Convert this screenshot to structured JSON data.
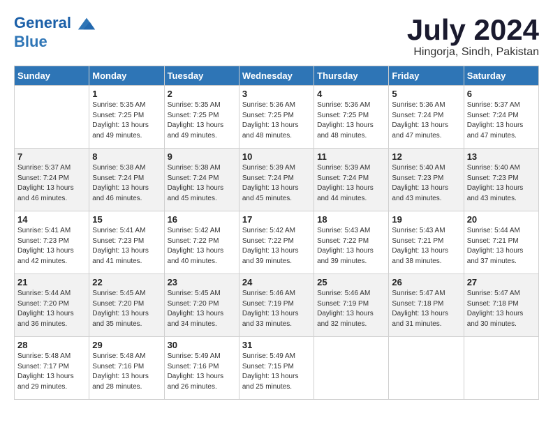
{
  "header": {
    "logo_line1": "General",
    "logo_line2": "Blue",
    "month": "July 2024",
    "location": "Hingorja, Sindh, Pakistan"
  },
  "weekdays": [
    "Sunday",
    "Monday",
    "Tuesday",
    "Wednesday",
    "Thursday",
    "Friday",
    "Saturday"
  ],
  "weeks": [
    [
      {
        "num": "",
        "info": ""
      },
      {
        "num": "1",
        "info": "Sunrise: 5:35 AM\nSunset: 7:25 PM\nDaylight: 13 hours\nand 49 minutes."
      },
      {
        "num": "2",
        "info": "Sunrise: 5:35 AM\nSunset: 7:25 PM\nDaylight: 13 hours\nand 49 minutes."
      },
      {
        "num": "3",
        "info": "Sunrise: 5:36 AM\nSunset: 7:25 PM\nDaylight: 13 hours\nand 48 minutes."
      },
      {
        "num": "4",
        "info": "Sunrise: 5:36 AM\nSunset: 7:25 PM\nDaylight: 13 hours\nand 48 minutes."
      },
      {
        "num": "5",
        "info": "Sunrise: 5:36 AM\nSunset: 7:24 PM\nDaylight: 13 hours\nand 47 minutes."
      },
      {
        "num": "6",
        "info": "Sunrise: 5:37 AM\nSunset: 7:24 PM\nDaylight: 13 hours\nand 47 minutes."
      }
    ],
    [
      {
        "num": "7",
        "info": "Sunrise: 5:37 AM\nSunset: 7:24 PM\nDaylight: 13 hours\nand 46 minutes."
      },
      {
        "num": "8",
        "info": "Sunrise: 5:38 AM\nSunset: 7:24 PM\nDaylight: 13 hours\nand 46 minutes."
      },
      {
        "num": "9",
        "info": "Sunrise: 5:38 AM\nSunset: 7:24 PM\nDaylight: 13 hours\nand 45 minutes."
      },
      {
        "num": "10",
        "info": "Sunrise: 5:39 AM\nSunset: 7:24 PM\nDaylight: 13 hours\nand 45 minutes."
      },
      {
        "num": "11",
        "info": "Sunrise: 5:39 AM\nSunset: 7:24 PM\nDaylight: 13 hours\nand 44 minutes."
      },
      {
        "num": "12",
        "info": "Sunrise: 5:40 AM\nSunset: 7:23 PM\nDaylight: 13 hours\nand 43 minutes."
      },
      {
        "num": "13",
        "info": "Sunrise: 5:40 AM\nSunset: 7:23 PM\nDaylight: 13 hours\nand 43 minutes."
      }
    ],
    [
      {
        "num": "14",
        "info": "Sunrise: 5:41 AM\nSunset: 7:23 PM\nDaylight: 13 hours\nand 42 minutes."
      },
      {
        "num": "15",
        "info": "Sunrise: 5:41 AM\nSunset: 7:23 PM\nDaylight: 13 hours\nand 41 minutes."
      },
      {
        "num": "16",
        "info": "Sunrise: 5:42 AM\nSunset: 7:22 PM\nDaylight: 13 hours\nand 40 minutes."
      },
      {
        "num": "17",
        "info": "Sunrise: 5:42 AM\nSunset: 7:22 PM\nDaylight: 13 hours\nand 39 minutes."
      },
      {
        "num": "18",
        "info": "Sunrise: 5:43 AM\nSunset: 7:22 PM\nDaylight: 13 hours\nand 39 minutes."
      },
      {
        "num": "19",
        "info": "Sunrise: 5:43 AM\nSunset: 7:21 PM\nDaylight: 13 hours\nand 38 minutes."
      },
      {
        "num": "20",
        "info": "Sunrise: 5:44 AM\nSunset: 7:21 PM\nDaylight: 13 hours\nand 37 minutes."
      }
    ],
    [
      {
        "num": "21",
        "info": "Sunrise: 5:44 AM\nSunset: 7:20 PM\nDaylight: 13 hours\nand 36 minutes."
      },
      {
        "num": "22",
        "info": "Sunrise: 5:45 AM\nSunset: 7:20 PM\nDaylight: 13 hours\nand 35 minutes."
      },
      {
        "num": "23",
        "info": "Sunrise: 5:45 AM\nSunset: 7:20 PM\nDaylight: 13 hours\nand 34 minutes."
      },
      {
        "num": "24",
        "info": "Sunrise: 5:46 AM\nSunset: 7:19 PM\nDaylight: 13 hours\nand 33 minutes."
      },
      {
        "num": "25",
        "info": "Sunrise: 5:46 AM\nSunset: 7:19 PM\nDaylight: 13 hours\nand 32 minutes."
      },
      {
        "num": "26",
        "info": "Sunrise: 5:47 AM\nSunset: 7:18 PM\nDaylight: 13 hours\nand 31 minutes."
      },
      {
        "num": "27",
        "info": "Sunrise: 5:47 AM\nSunset: 7:18 PM\nDaylight: 13 hours\nand 30 minutes."
      }
    ],
    [
      {
        "num": "28",
        "info": "Sunrise: 5:48 AM\nSunset: 7:17 PM\nDaylight: 13 hours\nand 29 minutes."
      },
      {
        "num": "29",
        "info": "Sunrise: 5:48 AM\nSunset: 7:16 PM\nDaylight: 13 hours\nand 28 minutes."
      },
      {
        "num": "30",
        "info": "Sunrise: 5:49 AM\nSunset: 7:16 PM\nDaylight: 13 hours\nand 26 minutes."
      },
      {
        "num": "31",
        "info": "Sunrise: 5:49 AM\nSunset: 7:15 PM\nDaylight: 13 hours\nand 25 minutes."
      },
      {
        "num": "",
        "info": ""
      },
      {
        "num": "",
        "info": ""
      },
      {
        "num": "",
        "info": ""
      }
    ]
  ]
}
